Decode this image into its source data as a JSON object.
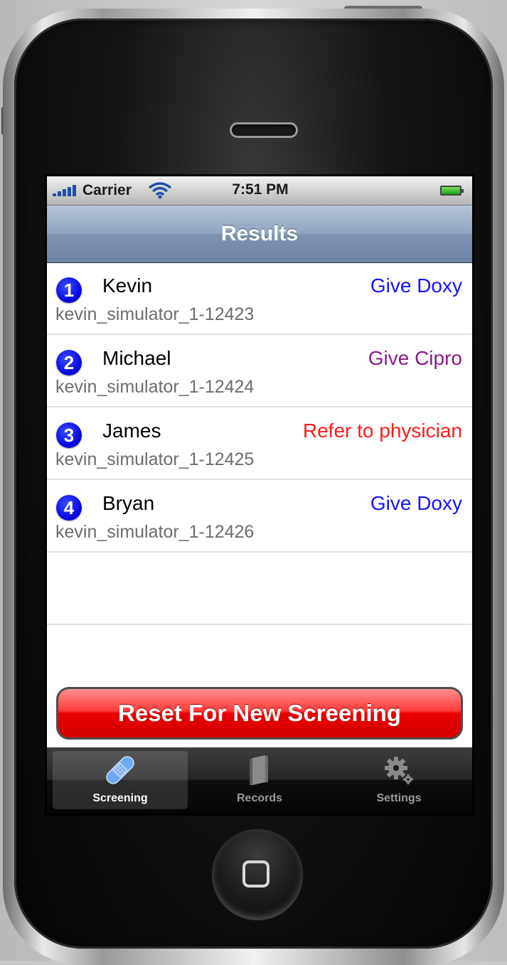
{
  "status_bar": {
    "carrier": "Carrier",
    "time": "7:51 PM"
  },
  "nav": {
    "title": "Results"
  },
  "results": [
    {
      "number": "1",
      "name": "Kevin",
      "action": "Give Doxy",
      "action_color": "#1414ff",
      "id": "kevin_simulator_1-12423"
    },
    {
      "number": "2",
      "name": "Michael",
      "action": "Give Cipro",
      "action_color": "#8a1a8a",
      "id": "kevin_simulator_1-12424"
    },
    {
      "number": "3",
      "name": "James",
      "action": "Refer to physician",
      "action_color": "#ff1a1a",
      "id": "kevin_simulator_1-12425"
    },
    {
      "number": "4",
      "name": "Bryan",
      "action": "Give Doxy",
      "action_color": "#1414ff",
      "id": "kevin_simulator_1-12426"
    }
  ],
  "reset_button": {
    "label": "Reset For New Screening"
  },
  "tabs": [
    {
      "label": "Screening",
      "icon": "bandage-icon",
      "selected": true
    },
    {
      "label": "Records",
      "icon": "book-icon",
      "selected": false
    },
    {
      "label": "Settings",
      "icon": "gear-icon",
      "selected": false
    }
  ],
  "colors": {
    "nav_bar": "#8fa3bf",
    "badge": "#0a0ae0",
    "reset_button": "#e80000",
    "tab_bar": "#0d0d0d"
  }
}
